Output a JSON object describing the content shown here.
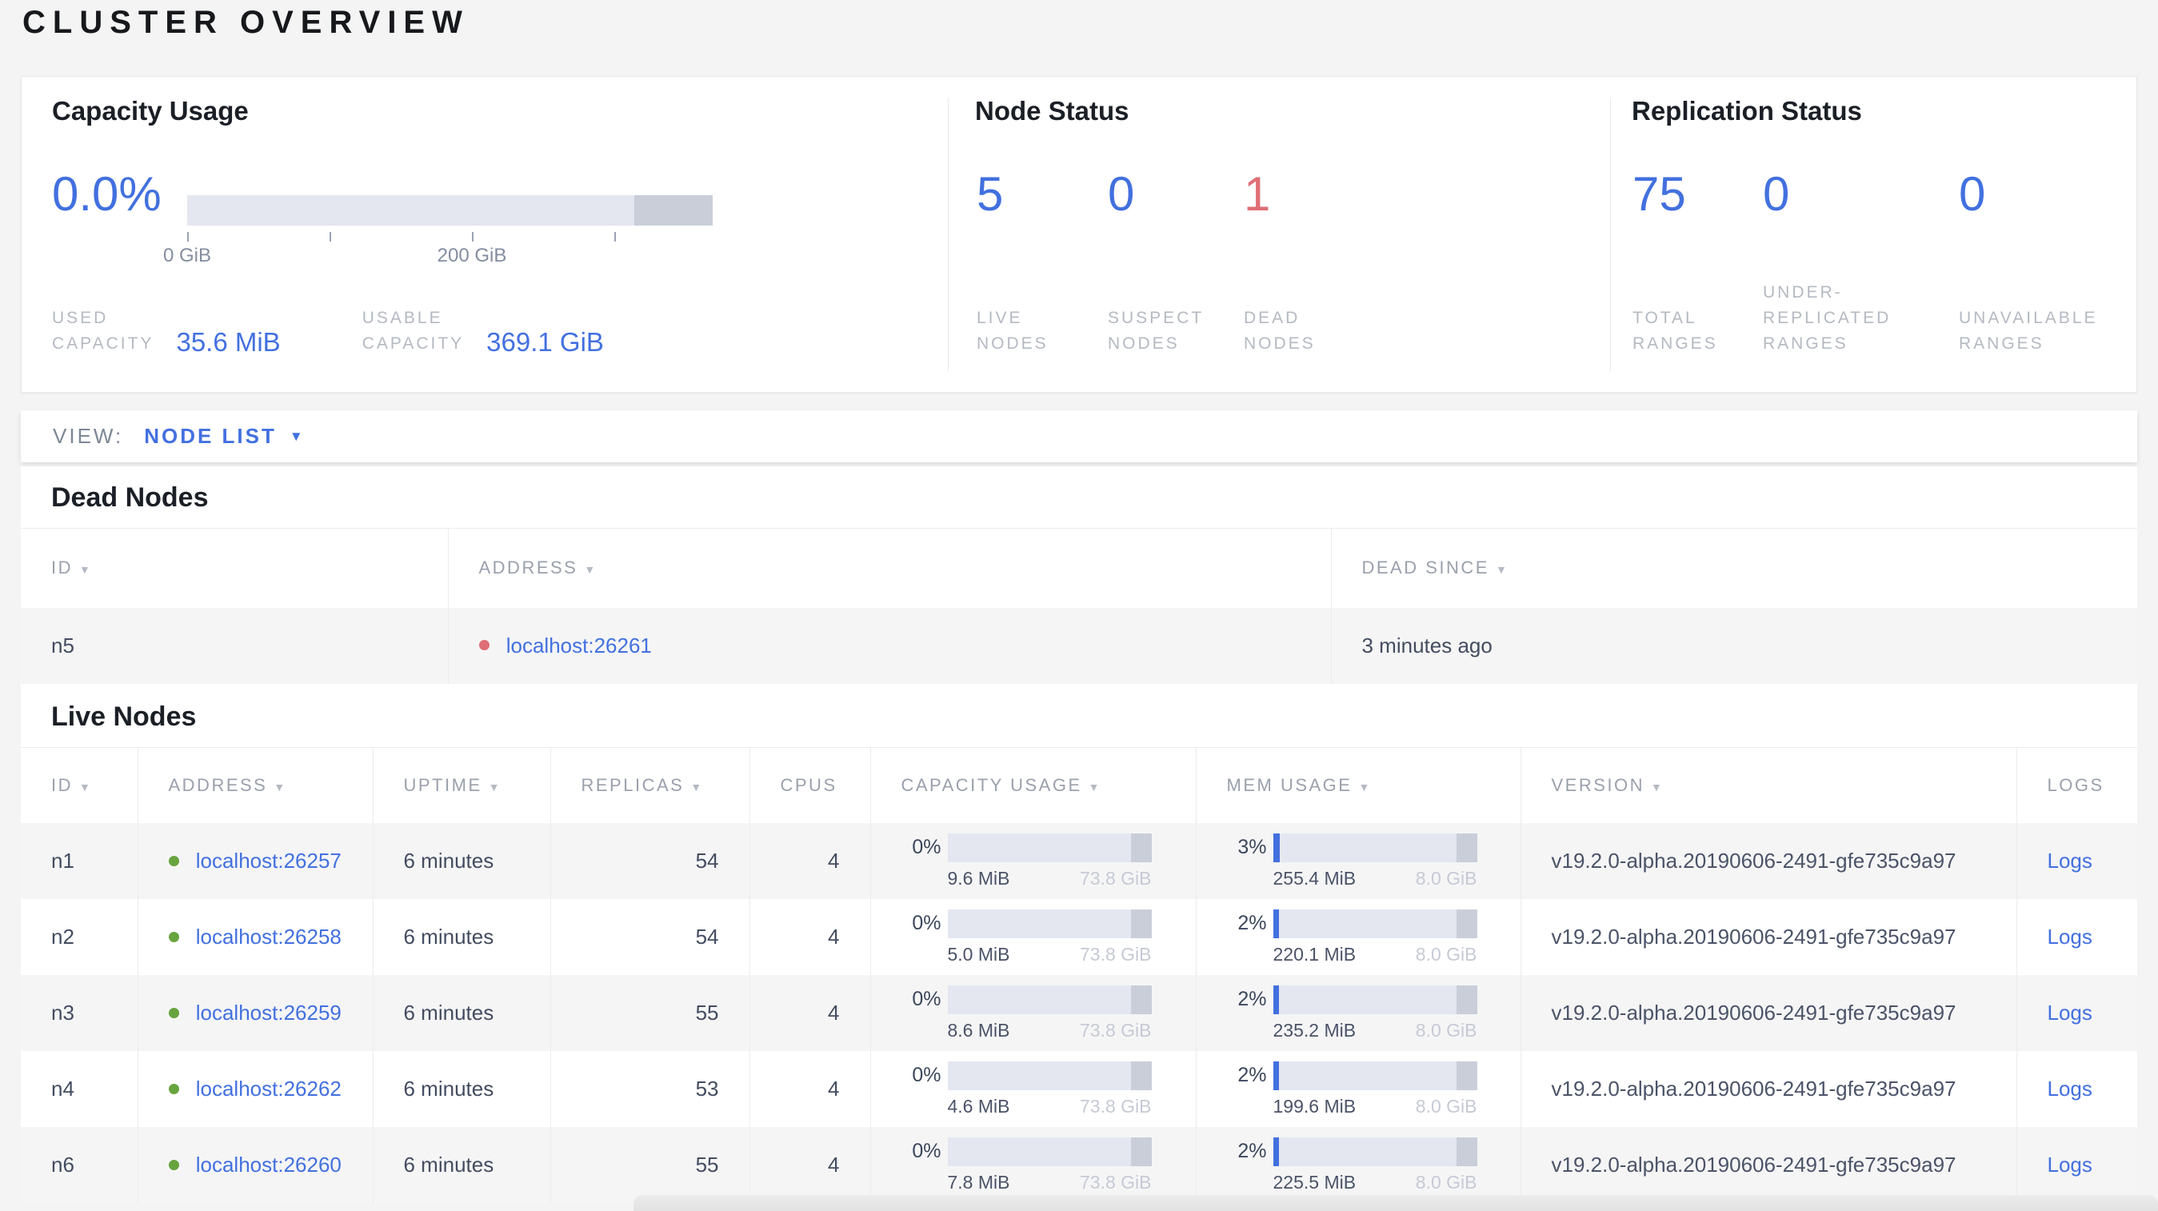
{
  "colors": {
    "blue": "#4270df",
    "red": "#df6e76",
    "green": "#68a43d"
  },
  "page": {
    "title": "CLUSTER OVERVIEW"
  },
  "summary": {
    "capacity": {
      "title": "Capacity Usage",
      "percent": "0.0%",
      "ticks": [
        "0 GiB",
        "200 GiB"
      ],
      "stats": [
        {
          "lines": [
            "USED",
            "CAPACITY"
          ],
          "value": "35.6 MiB"
        },
        {
          "lines": [
            "USABLE",
            "CAPACITY"
          ],
          "value": "369.1 GiB"
        }
      ]
    },
    "node_status": {
      "title": "Node Status",
      "stats": [
        {
          "value": "5",
          "color": "#4270df",
          "lines": [
            "LIVE",
            "NODES"
          ]
        },
        {
          "value": "0",
          "color": "#4270df",
          "lines": [
            "SUSPECT",
            "NODES"
          ]
        },
        {
          "value": "1",
          "color": "#df6e76",
          "lines": [
            "DEAD",
            "NODES"
          ]
        }
      ]
    },
    "replication": {
      "title": "Replication Status",
      "stats": [
        {
          "value": "75",
          "color": "#4270df",
          "lines": [
            "TOTAL",
            "RANGES"
          ]
        },
        {
          "value": "0",
          "color": "#4270df",
          "lines": [
            "UNDER-",
            "REPLICATED",
            "RANGES"
          ]
        },
        {
          "value": "0",
          "color": "#4270df",
          "lines": [
            "UNAVAILABLE",
            "RANGES"
          ]
        }
      ]
    }
  },
  "view_bar": {
    "label": "VIEW:",
    "selected": "NODE LIST",
    "caret": "▼"
  },
  "dead_nodes": {
    "title": "Dead Nodes",
    "columns": [
      {
        "label": "ID",
        "arrow": "▼"
      },
      {
        "label": "ADDRESS",
        "arrow": "▼"
      },
      {
        "label": "DEAD SINCE",
        "arrow": "▼"
      }
    ],
    "rows": [
      {
        "id": "n5",
        "status_color": "#df6e76",
        "address": "localhost:26261",
        "dead_since": "3 minutes ago"
      }
    ]
  },
  "live_nodes": {
    "title": "Live Nodes",
    "logs_label": "Logs",
    "columns": [
      {
        "label": "ID",
        "arrow": "▼"
      },
      {
        "label": "ADDRESS",
        "arrow": "▼"
      },
      {
        "label": "UPTIME",
        "arrow": "▼"
      },
      {
        "label": "REPLICAS",
        "arrow": "▼"
      },
      {
        "label": "CPUS",
        "arrow": ""
      },
      {
        "label": "CAPACITY USAGE",
        "arrow": "▼"
      },
      {
        "label": "MEM USAGE",
        "arrow": "▼"
      },
      {
        "label": "VERSION",
        "arrow": "▼"
      },
      {
        "label": "LOGS",
        "arrow": ""
      }
    ],
    "rows": [
      {
        "id": "n1",
        "status_color": "#68a43d",
        "address": "localhost:26257",
        "uptime": "6 minutes",
        "replicas": "54",
        "cpus": "4",
        "cap_pct": "0%",
        "cap_fill": 0,
        "cap_used": "9.6 MiB",
        "cap_total": "73.8 GiB",
        "mem_pct": "3%",
        "mem_fill": 3.5,
        "mem_used": "255.4 MiB",
        "mem_total": "8.0 GiB",
        "version": "v19.2.0-alpha.20190606-2491-gfe735c9a97"
      },
      {
        "id": "n2",
        "status_color": "#68a43d",
        "address": "localhost:26258",
        "uptime": "6 minutes",
        "replicas": "54",
        "cpus": "4",
        "cap_pct": "0%",
        "cap_fill": 0,
        "cap_used": "5.0 MiB",
        "cap_total": "73.8 GiB",
        "mem_pct": "2%",
        "mem_fill": 3,
        "mem_used": "220.1 MiB",
        "mem_total": "8.0 GiB",
        "version": "v19.2.0-alpha.20190606-2491-gfe735c9a97"
      },
      {
        "id": "n3",
        "status_color": "#68a43d",
        "address": "localhost:26259",
        "uptime": "6 minutes",
        "replicas": "55",
        "cpus": "4",
        "cap_pct": "0%",
        "cap_fill": 0,
        "cap_used": "8.6 MiB",
        "cap_total": "73.8 GiB",
        "mem_pct": "2%",
        "mem_fill": 3,
        "mem_used": "235.2 MiB",
        "mem_total": "8.0 GiB",
        "version": "v19.2.0-alpha.20190606-2491-gfe735c9a97"
      },
      {
        "id": "n4",
        "status_color": "#68a43d",
        "address": "localhost:26262",
        "uptime": "6 minutes",
        "replicas": "53",
        "cpus": "4",
        "cap_pct": "0%",
        "cap_fill": 0,
        "cap_used": "4.6 MiB",
        "cap_total": "73.8 GiB",
        "mem_pct": "2%",
        "mem_fill": 3,
        "mem_used": "199.6 MiB",
        "mem_total": "8.0 GiB",
        "version": "v19.2.0-alpha.20190606-2491-gfe735c9a97"
      },
      {
        "id": "n6",
        "status_color": "#68a43d",
        "address": "localhost:26260",
        "uptime": "6 minutes",
        "replicas": "55",
        "cpus": "4",
        "cap_pct": "0%",
        "cap_fill": 0,
        "cap_used": "7.8 MiB",
        "cap_total": "73.8 GiB",
        "mem_pct": "2%",
        "mem_fill": 3,
        "mem_used": "225.5 MiB",
        "mem_total": "8.0 GiB",
        "version": "v19.2.0-alpha.20190606-2491-gfe735c9a97"
      }
    ]
  }
}
